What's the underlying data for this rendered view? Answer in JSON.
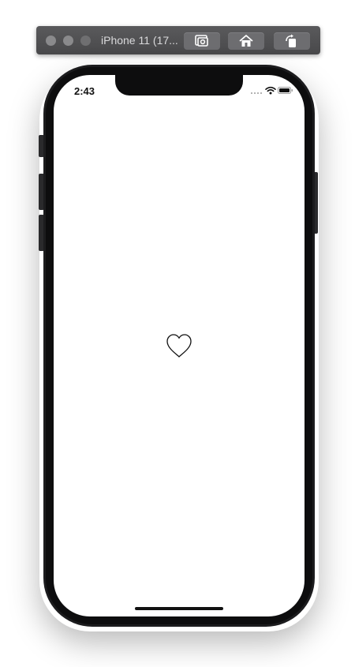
{
  "simulator": {
    "title": "iPhone 11 (17...",
    "buttons": {
      "screenshot": "screenshot-icon",
      "home": "home-icon",
      "rotate": "rotate-icon"
    }
  },
  "status_bar": {
    "time": "2:43",
    "icons": [
      "cellular-signal-icon",
      "wifi-icon",
      "battery-icon"
    ]
  },
  "screen": {
    "center_icon": "heart-outline-icon",
    "liked": false
  },
  "colors": {
    "device_body": "#1c1c1e",
    "screen_background": "#ffffff",
    "toolbar": "#4f4f51",
    "icon_stroke": "#111111"
  }
}
